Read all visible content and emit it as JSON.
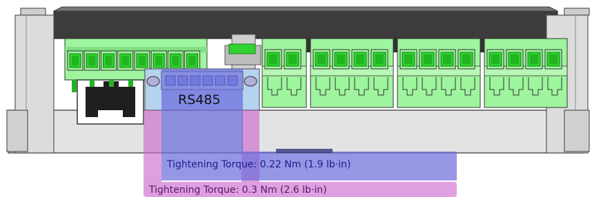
{
  "labels": {
    "connector": "RS485",
    "torque_small": "Tightening Torque: 0.22 Nm (1.9 lb·in)",
    "torque_large": "Tightening Torque: 0.3 Nm (2.6 lb·in)"
  },
  "colors": {
    "terminal_green": "#9ef59e",
    "terminal_dark": "#21b521",
    "screw_green": "#2fd42f",
    "blue_overlay": "#6b6bdc",
    "pink_overlay": "#cc66cc",
    "rs485_header": "#b5d2ee",
    "rs485_pins": "#7ea0e0",
    "housing_grey": "#e0e0e0",
    "housing_dark": "#3c3c3c"
  },
  "terminal_groups": {
    "left_block_positions": 8,
    "right_block_groups": [
      2,
      4,
      4,
      4
    ]
  }
}
